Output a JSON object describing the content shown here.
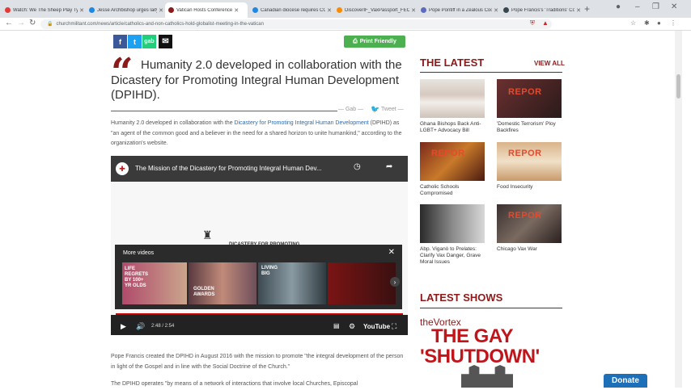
{
  "browser": {
    "tabs": [
      {
        "title": "Watch: We The Sheep Play Ty Yo",
        "color": "#e53935"
      },
      {
        "title": "Jesse Archbishop urges laity to",
        "color": "#1e88e5"
      },
      {
        "title": "Vatican Hosts Conference",
        "color": "#8b1a1a",
        "active": true
      },
      {
        "title": "Canadian diocese requires COV",
        "color": "#1e88e5"
      },
      {
        "title": "DiscoverIF_VaxPassport_FECO",
        "color": "#fb8c00"
      },
      {
        "title": "Pope Pontiff in a Zealous Coo",
        "color": "#5c6bc0"
      },
      {
        "title": "Pope Francis's 'Traditions' Cons",
        "color": "#37474f"
      }
    ],
    "new_tab": "+",
    "url": "churchmilitant.com/news/article/catholics-and-non-catholics-hold-globalist-meeting-in-the-vatican",
    "lock_icon": "lock-icon",
    "win_controls": [
      "–",
      "❐",
      "✕"
    ]
  },
  "share": {
    "facebook": "f",
    "twitter": "t",
    "gab": "gab",
    "email": "✉",
    "print_label": "Print Friendly"
  },
  "article": {
    "quote": "Humanity 2.0 developed in collaboration with the Dicastery for Promoting Integral Human Development (DPIHD).",
    "gab_link": "— Gab —",
    "tweet_link": "Tweet —",
    "para1_pre": "Humanity 2.0 developed in collaboration with the ",
    "para1_link": "Dicastery for Promoting Integral Human Development",
    "para1_post": " (DPIHD) as \"an agent of the common good and a believer in the need for a shared horizon to unite humankind,\" according to the organization's website.",
    "para2": "Pope Francis created the DPIHD in August 2016 with the mission to promote \"the integral development of the person in light of the Gospel and in line with the Social Doctrine of the Church.\"",
    "para3": "The DPIHD operates \"by means of a network of interactions that involve local Churches, Episcopal"
  },
  "video": {
    "title": "The Mission of the Dicastery for Promoting Integral Human Dev...",
    "center_text": "DICASTERY FOR PROMOTING",
    "time": "2:48 / 2:54",
    "youtube": "YouTube",
    "more_videos": "More videos",
    "thumb_texts": [
      "LIFE REGRETS BY 100+ YR OLDS",
      "GOLDEN AWARDS",
      "LIVING BIG"
    ],
    "accent": "#cc0000"
  },
  "sidebar": {
    "latest_title": "THE LATEST",
    "view_all": "VIEW ALL",
    "cards": [
      {
        "caption": "Ghana Bishops Back Anti-LGBT+ Advocacy Bill",
        "report": ""
      },
      {
        "caption": "'Domestic Terrorism' Ploy Backfires",
        "report": "REPOR"
      },
      {
        "caption": "Catholic Schools Compromised",
        "report": "REPOR"
      },
      {
        "caption": "Food Insecurity",
        "report": "REPOR"
      },
      {
        "caption": "Abp. Viganò to Prelates: Clarify Vax Danger, Grave Moral Issues",
        "report": ""
      },
      {
        "caption": "Chicago Vax War",
        "report": "REPOR"
      }
    ],
    "shows_title": "LATEST SHOWS",
    "vortex_the": "theVortex",
    "vortex_line1": "THE GAY",
    "vortex_line2": "'SHUTDOWN'"
  },
  "donate": "Donate"
}
